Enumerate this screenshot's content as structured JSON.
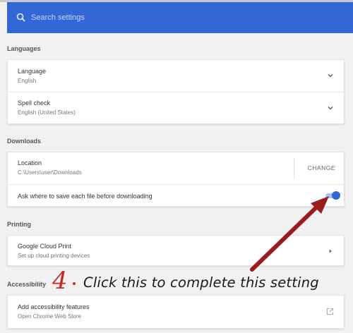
{
  "search": {
    "placeholder": "Search settings"
  },
  "sections": {
    "languages": {
      "title": "Languages",
      "items": [
        {
          "label": "Language",
          "value": "English"
        },
        {
          "label": "Spell check",
          "value": "English (United States)"
        }
      ]
    },
    "downloads": {
      "title": "Downloads",
      "location_label": "Location",
      "location_value": "C:\\Users\\user\\Downloads",
      "change_label": "CHANGE",
      "ask_label": "Ask where to save each file before downloading",
      "ask_enabled": true
    },
    "printing": {
      "title": "Printing",
      "item_label": "Google Cloud Print",
      "item_sub": "Set up cloud printing devices"
    },
    "accessibility": {
      "title": "Accessibility",
      "item_label": "Add accessibility features",
      "item_sub": "Open Chrome Web Store"
    }
  },
  "annotation": {
    "step": "4",
    "text": "Click this to complete this setting"
  },
  "colors": {
    "header": "#3367d6",
    "toggle_on": "#3367d6",
    "annotation_red": "#c62828",
    "arrow": "#9b1c1c"
  }
}
